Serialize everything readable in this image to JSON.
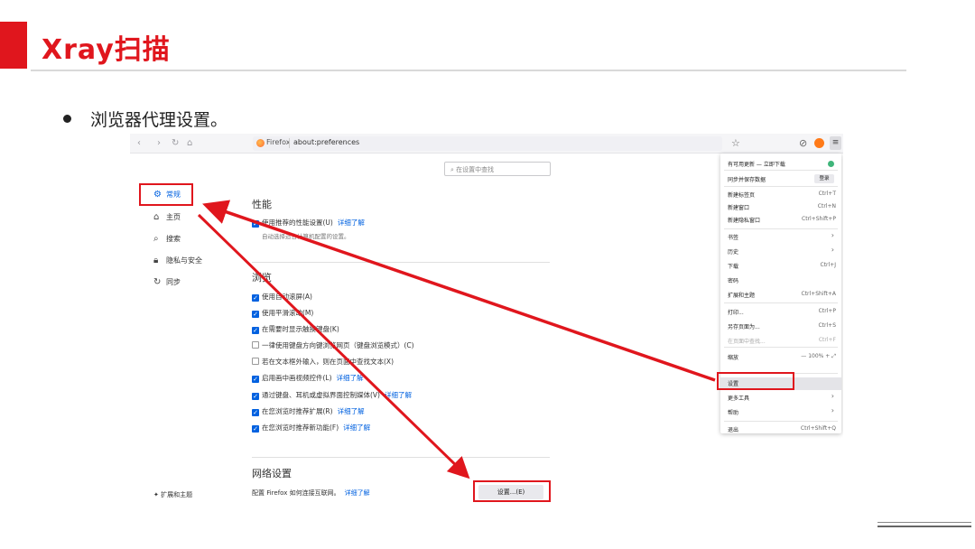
{
  "slide": {
    "title": "Xray扫描",
    "bullet": "浏览器代理设置。"
  },
  "browser": {
    "app_name": "Firefox",
    "url": "about:preferences",
    "search_placeholder": "在设置中查找",
    "sidebar": {
      "items": [
        {
          "label": "常规",
          "icon": "gear-icon",
          "active": true
        },
        {
          "label": "主页",
          "icon": "home-icon"
        },
        {
          "label": "搜索",
          "icon": "search-icon"
        },
        {
          "label": "隐私与安全",
          "icon": "lock-icon"
        },
        {
          "label": "同步",
          "icon": "sync-icon"
        }
      ],
      "extensions_label": "扩展和主题"
    },
    "performance": {
      "title": "性能",
      "option": "使用推荐的性能设置(U)",
      "learn_more": "详细了解",
      "hint": "自动选择适合计算机配置的设置。"
    },
    "browsing": {
      "title": "浏览",
      "options": [
        {
          "label": "使用自动滚屏(A)",
          "checked": true,
          "learn_more": ""
        },
        {
          "label": "使用平滑滚动(M)",
          "checked": true,
          "learn_more": ""
        },
        {
          "label": "在需要时显示触摸键盘(K)",
          "checked": true,
          "learn_more": ""
        },
        {
          "label": "一律使用键盘方向键浏览网页（键盘浏览模式）(C)",
          "checked": false,
          "learn_more": ""
        },
        {
          "label": "若在文本框外输入，则在页面中查找文本(X)",
          "checked": false,
          "learn_more": ""
        },
        {
          "label": "启用画中画视频控件(L)",
          "checked": true,
          "learn_more": "详细了解"
        },
        {
          "label": "通过键盘、耳机或虚拟界面控制媒体(V)",
          "checked": true,
          "learn_more": "详细了解"
        },
        {
          "label": "在您浏览时推荐扩展(R)",
          "checked": true,
          "learn_more": "详细了解"
        },
        {
          "label": "在您浏览时推荐新功能(F)",
          "checked": true,
          "learn_more": "详细了解"
        }
      ]
    },
    "network": {
      "title": "网络设置",
      "description": "配置 Firefox 如何连接互联网。",
      "learn_more": "详细了解",
      "button": "设置...(E)"
    },
    "menu": {
      "update_text": "有可用更新 — 立即下载",
      "sync_text": "同步并保存数据",
      "login": "登录",
      "items": [
        {
          "label": "新建标签页",
          "shortcut": "Ctrl+T"
        },
        {
          "label": "新建窗口",
          "shortcut": "Ctrl+N"
        },
        {
          "label": "新建隐私窗口",
          "shortcut": "Ctrl+Shift+P"
        },
        {
          "label": "书签",
          "shortcut": "›"
        },
        {
          "label": "历史",
          "shortcut": "›"
        },
        {
          "label": "下载",
          "shortcut": "Ctrl+J"
        },
        {
          "label": "密码",
          "shortcut": ""
        },
        {
          "label": "扩展和主题",
          "shortcut": "Ctrl+Shift+A"
        },
        {
          "label": "打印...",
          "shortcut": "Ctrl+P"
        },
        {
          "label": "另存页面为...",
          "shortcut": "Ctrl+S"
        },
        {
          "label": "在页面中查找...",
          "shortcut": "Ctrl+F"
        },
        {
          "label": "缩放",
          "shortcut": "—   100%  +  ⤢"
        },
        {
          "label": "设置",
          "shortcut": ""
        },
        {
          "label": "更多工具",
          "shortcut": "›"
        },
        {
          "label": "帮助",
          "shortcut": "›"
        },
        {
          "label": "退出",
          "shortcut": "Ctrl+Shift+Q"
        }
      ]
    }
  },
  "colors": {
    "accent_red": "#e0161d",
    "firefox_blue": "#0061e0"
  }
}
